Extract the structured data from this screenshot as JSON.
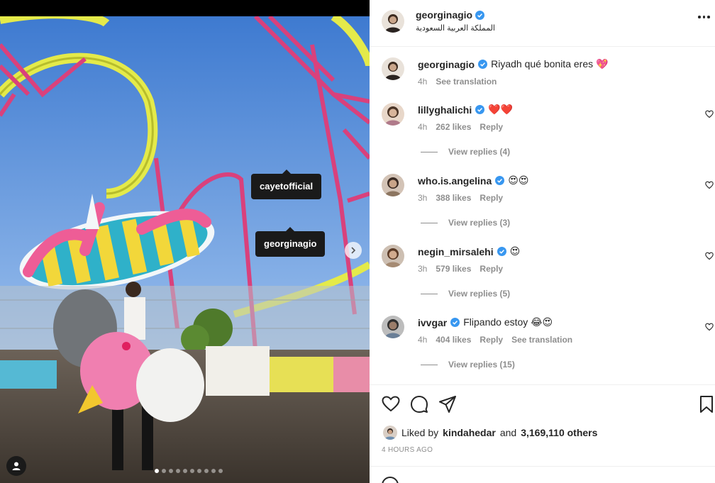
{
  "post": {
    "author": "georginagio",
    "location": "المملكة العربية السعودية",
    "caption_text": "Riyadh qué bonita eres 💖",
    "caption_time": "4h",
    "caption_translate": "See translation"
  },
  "media": {
    "tags": [
      "cayetofficial",
      "georginagio"
    ],
    "carousel_count": 10,
    "carousel_active": 1
  },
  "comments": [
    {
      "user": "lillyghalichi",
      "text": "❤️❤️",
      "time": "4h",
      "likes": "262 likes",
      "reply": "Reply",
      "translate": "",
      "view_replies": "View replies (4)"
    },
    {
      "user": "who.is.angelina",
      "text": "😍😍",
      "time": "3h",
      "likes": "388 likes",
      "reply": "Reply",
      "translate": "",
      "view_replies": "View replies (3)"
    },
    {
      "user": "negin_mirsalehi",
      "text": "😍",
      "time": "3h",
      "likes": "579 likes",
      "reply": "Reply",
      "translate": "",
      "view_replies": "View replies (5)"
    },
    {
      "user": "ivvgar",
      "text": "Flipando estoy 😂😍",
      "time": "4h",
      "likes": "404 likes",
      "reply": "Reply",
      "translate": "See translation",
      "view_replies": "View replies (15)"
    }
  ],
  "footer": {
    "liked_prefix": "Liked by",
    "liked_user": "kindahedar",
    "liked_and": "and",
    "liked_others": "3,169,110 others",
    "timestamp": "4 HOURS AGO"
  },
  "colors": {
    "verified": "#3897f0",
    "text": "#262626",
    "secondary": "#8e8e8e",
    "border": "#efefef"
  }
}
